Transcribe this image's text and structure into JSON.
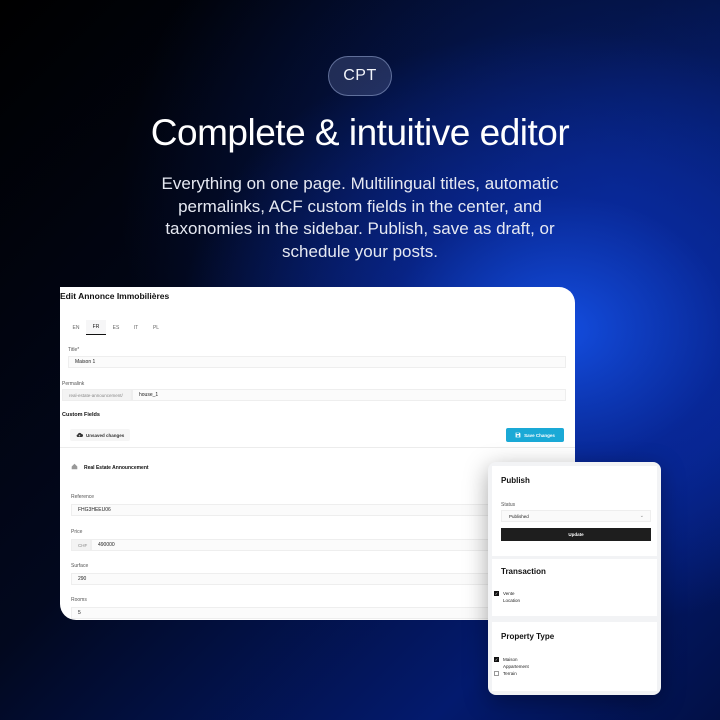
{
  "badge": "CPT",
  "hero": {
    "title": "Complete & intuitive editor",
    "subtitle": "Everything on one page. Multilingual titles, automatic permalinks, ACF custom fields in the center, and taxonomies in the sidebar. Publish, save as draft, or schedule your posts."
  },
  "editor": {
    "title": "Edit Annonce Immobilières",
    "tabs": [
      {
        "label": "EN",
        "active": false
      },
      {
        "label": "FR",
        "active": true
      },
      {
        "label": "ES",
        "active": false
      },
      {
        "label": "IT",
        "active": false
      },
      {
        "label": "PL",
        "active": false
      }
    ],
    "title_label": "Title*",
    "title_value": "Maison 1",
    "permalink_label": "Permalink",
    "permalink_prefix": "real-estate-announcement/",
    "permalink_value": "house_1",
    "custom_fields_label": "Custom Fields",
    "unsaved_label": "Unsaved changes",
    "save_label": "Save Changes",
    "group_title": "Real Estate Announcement",
    "fields": {
      "reference_label": "Reference",
      "reference_value": "FHG3HEEU06",
      "price_label": "Price",
      "price_currency": "CHF",
      "price_value": "490000",
      "surface_label": "Surface",
      "surface_value": "290",
      "rooms_label": "Rooms",
      "rooms_value": "5"
    }
  },
  "sidebar": {
    "publish": {
      "title": "Publish",
      "status_label": "Status",
      "status_value": "Published",
      "update_label": "Update"
    },
    "transaction": {
      "title": "Transaction",
      "options": [
        {
          "label": "Vente",
          "checked": true
        },
        {
          "label": "Location",
          "checked": false
        }
      ]
    },
    "property_type": {
      "title": "Property Type",
      "options": [
        {
          "label": "Maison",
          "checked": true
        },
        {
          "label": "Appartement",
          "checked": false
        },
        {
          "label": "Terrain",
          "checked": false
        }
      ]
    }
  },
  "colors": {
    "accent": "#1aa9d6",
    "button_dark": "#1e1e1e"
  }
}
